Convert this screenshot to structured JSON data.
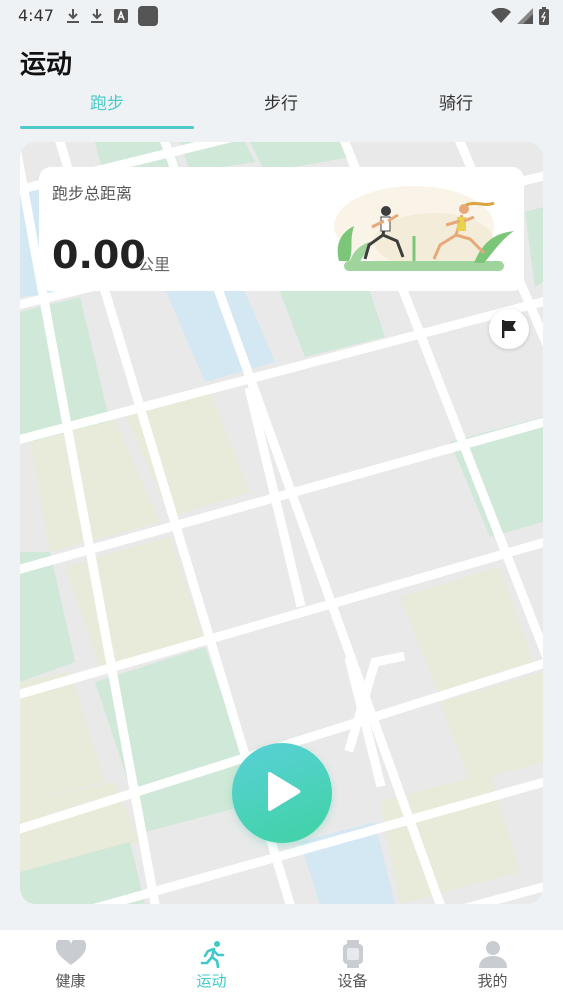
{
  "status_bar": {
    "time": "4:47",
    "left_icons": [
      "download-icon",
      "download-icon",
      "font-app-icon",
      "app-square-icon"
    ],
    "right_icons": [
      "wifi-icon",
      "cellular-signal-icon",
      "battery-icon"
    ]
  },
  "header": {
    "title": "运动"
  },
  "tabs": [
    {
      "label": "跑步",
      "active": true
    },
    {
      "label": "步行",
      "active": false
    },
    {
      "label": "骑行",
      "active": false
    }
  ],
  "stat_card": {
    "label": "跑步总距离",
    "value": "0.00",
    "unit": "公里",
    "illustration": "runners-illustration"
  },
  "map": {
    "flag_icon": "flag-icon",
    "start_icon": "play-icon"
  },
  "colors": {
    "accent": "#4ecbc9",
    "play_gradient_start": "#59d0d8",
    "play_gradient_end": "#3fd3a3",
    "map_green": "#cfe8d7",
    "map_olive": "#e8ebda",
    "map_blue": "#d3e8f3",
    "map_gray": "#e9e9e9"
  },
  "bottom_nav": [
    {
      "label": "健康",
      "icon": "heart-icon",
      "active": false
    },
    {
      "label": "运动",
      "icon": "running-icon",
      "active": true
    },
    {
      "label": "设备",
      "icon": "watch-icon",
      "active": false
    },
    {
      "label": "我的",
      "icon": "person-icon",
      "active": false
    }
  ]
}
